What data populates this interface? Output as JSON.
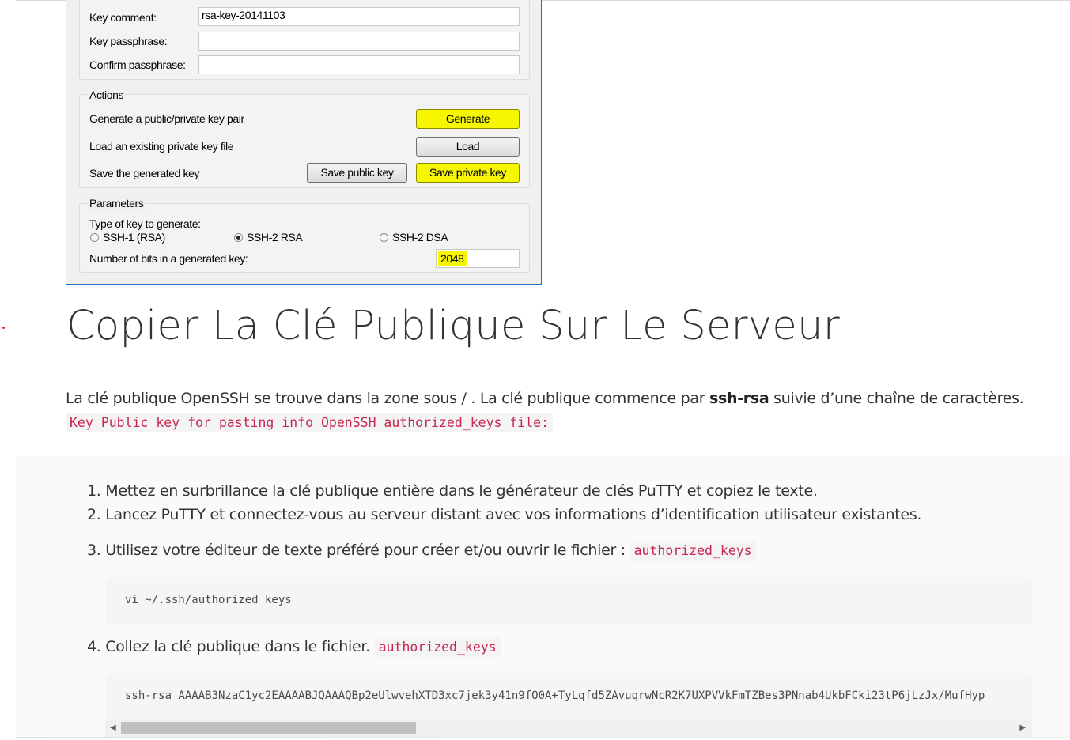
{
  "putty": {
    "key_comment_label": "Key comment:",
    "key_comment_value": "rsa-key-20141103",
    "key_passphrase_label": "Key passphrase:",
    "confirm_passphrase_label": "Confirm passphrase:",
    "actions_legend": "Actions",
    "generate_label": "Generate a public/private key pair",
    "generate_button": "Generate",
    "load_label": "Load an existing private key file",
    "load_button": "Load",
    "save_label": "Save the generated key",
    "save_public_button": "Save public key",
    "save_private_button": "Save private key",
    "parameters_legend": "Parameters",
    "key_type_label": "Type of key to generate:",
    "radio_ssh1": "SSH-1 (RSA)",
    "radio_ssh2rsa": "SSH-2 RSA",
    "radio_ssh2dsa": "SSH-2 DSA",
    "bits_label": "Number of bits in a generated key:",
    "bits_value": "2048",
    "highlight_color": "#f6f600"
  },
  "article": {
    "title": "Copier La Clé Publique Sur Le Serveur",
    "intro_start": "La clé publique OpenSSH se trouve dans la zone sous / . La clé publique commence par ",
    "intro_bold": "ssh-rsa",
    "intro_end": " suivie d’une chaîne de caractères.",
    "inline_key": "Key",
    "inline_phrase": "Public key for pasting info OpenSSH authorized_keys file:",
    "steps": [
      "1. Mettez en surbrillance la clé publique entière dans le générateur de clés PuTTY et copiez le texte.",
      "2. Lancez PuTTY et connectez-vous au serveur distant avec vos informations d’identification utilisateur existantes.",
      "3. Utilisez votre éditeur de texte préféré pour créer et/ou ouvrir le fichier : ",
      "4. Collez la clé publique dans le fichier. "
    ],
    "step3_code": "authorized_keys",
    "step4_code": "authorized_keys",
    "code_block_1": "vi ~/.ssh/authorized_keys",
    "code_block_2": "ssh-rsa AAAAB3NzaC1yc2EAAAABJQAAAQBp2eUlwvehXTD3xc7jek3y41n9fO0A+TyLqfd5ZAvuqrwNcR2K7UXPVVkFmTZBes3PNnab4UkbFCki23tP6jLzJx/MufHyp",
    "inline_code_color": "#c7254e"
  }
}
